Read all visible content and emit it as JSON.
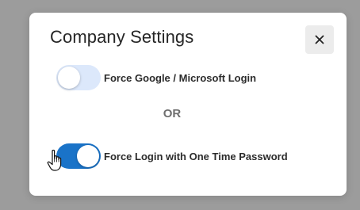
{
  "dialog": {
    "title": "Company Settings",
    "close_icon": "close-icon",
    "options": [
      {
        "label": "Force Google / Microsoft Login",
        "enabled": false
      },
      {
        "label": "Force Login with One Time Password",
        "enabled": true
      }
    ],
    "separator": "OR"
  },
  "colors": {
    "toggle_on": "#1a73c8",
    "toggle_off": "#dce8fb",
    "backdrop": "#9c9c9c"
  },
  "cursor": "hand-pointer-icon"
}
